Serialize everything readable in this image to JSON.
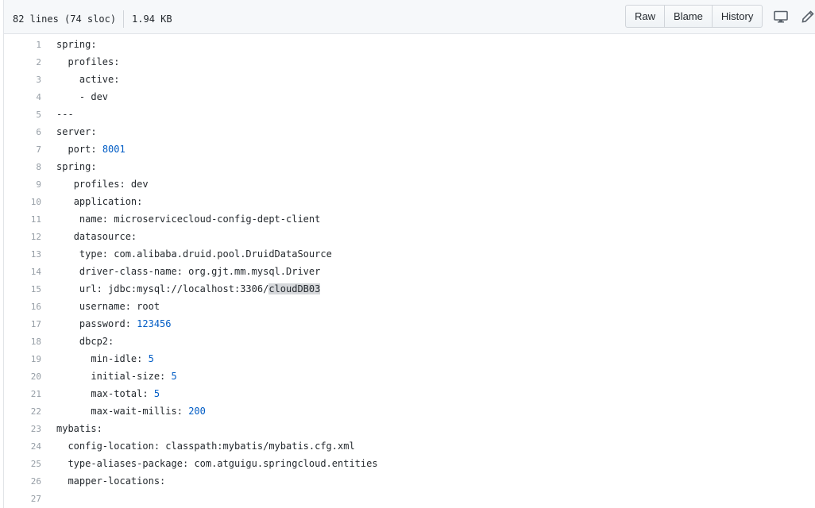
{
  "file_info": {
    "lines": "82 lines (74 sloc)",
    "size": "1.94 KB"
  },
  "actions": {
    "raw": "Raw",
    "blame": "Blame",
    "history": "History",
    "desktop_icon": "desktop-icon",
    "edit_icon": "pencil-icon"
  },
  "code": [
    {
      "n": "1",
      "indent": "",
      "text": "spring:",
      "value": ""
    },
    {
      "n": "2",
      "indent": "  ",
      "text": "profiles:",
      "value": ""
    },
    {
      "n": "3",
      "indent": "    ",
      "text": "active:",
      "value": ""
    },
    {
      "n": "4",
      "indent": "    ",
      "text": "- dev",
      "value": ""
    },
    {
      "n": "5",
      "indent": "",
      "text": "---",
      "value": ""
    },
    {
      "n": "6",
      "indent": "",
      "text": "server:",
      "value": ""
    },
    {
      "n": "7",
      "indent": "  ",
      "text": "port: ",
      "value": "8001"
    },
    {
      "n": "8",
      "indent": "",
      "text": "spring:",
      "value": ""
    },
    {
      "n": "9",
      "indent": "   ",
      "text": "profiles: dev",
      "value": ""
    },
    {
      "n": "10",
      "indent": "   ",
      "text": "application:",
      "value": ""
    },
    {
      "n": "11",
      "indent": "    ",
      "text": "name: microservicecloud-config-dept-client",
      "value": ""
    },
    {
      "n": "12",
      "indent": "   ",
      "text": "datasource:",
      "value": ""
    },
    {
      "n": "13",
      "indent": "    ",
      "text": "type: com.alibaba.druid.pool.DruidDataSource",
      "value": ""
    },
    {
      "n": "14",
      "indent": "    ",
      "text": "driver-class-name: org.gjt.mm.mysql.Driver",
      "value": ""
    },
    {
      "n": "15",
      "indent": "    ",
      "text": "url: jdbc:mysql://localhost:3306/",
      "value": "",
      "highlight": "cloudDB03"
    },
    {
      "n": "16",
      "indent": "    ",
      "text": "username: root",
      "value": ""
    },
    {
      "n": "17",
      "indent": "    ",
      "text": "password: ",
      "value": "123456"
    },
    {
      "n": "18",
      "indent": "    ",
      "text": "dbcp2:",
      "value": ""
    },
    {
      "n": "19",
      "indent": "      ",
      "text": "min-idle: ",
      "value": "5"
    },
    {
      "n": "20",
      "indent": "      ",
      "text": "initial-size: ",
      "value": "5"
    },
    {
      "n": "21",
      "indent": "      ",
      "text": "max-total: ",
      "value": "5"
    },
    {
      "n": "22",
      "indent": "      ",
      "text": "max-wait-millis: ",
      "value": "200"
    },
    {
      "n": "23",
      "indent": "",
      "text": "mybatis:",
      "value": ""
    },
    {
      "n": "24",
      "indent": "  ",
      "text": "config-location: classpath:mybatis/mybatis.cfg.xml",
      "value": ""
    },
    {
      "n": "25",
      "indent": "  ",
      "text": "type-aliases-package: com.atguigu.springcloud.entities",
      "value": ""
    },
    {
      "n": "26",
      "indent": "  ",
      "text": "mapper-locations:",
      "value": ""
    },
    {
      "n": "27",
      "indent": "",
      "text": "",
      "value": ""
    }
  ]
}
